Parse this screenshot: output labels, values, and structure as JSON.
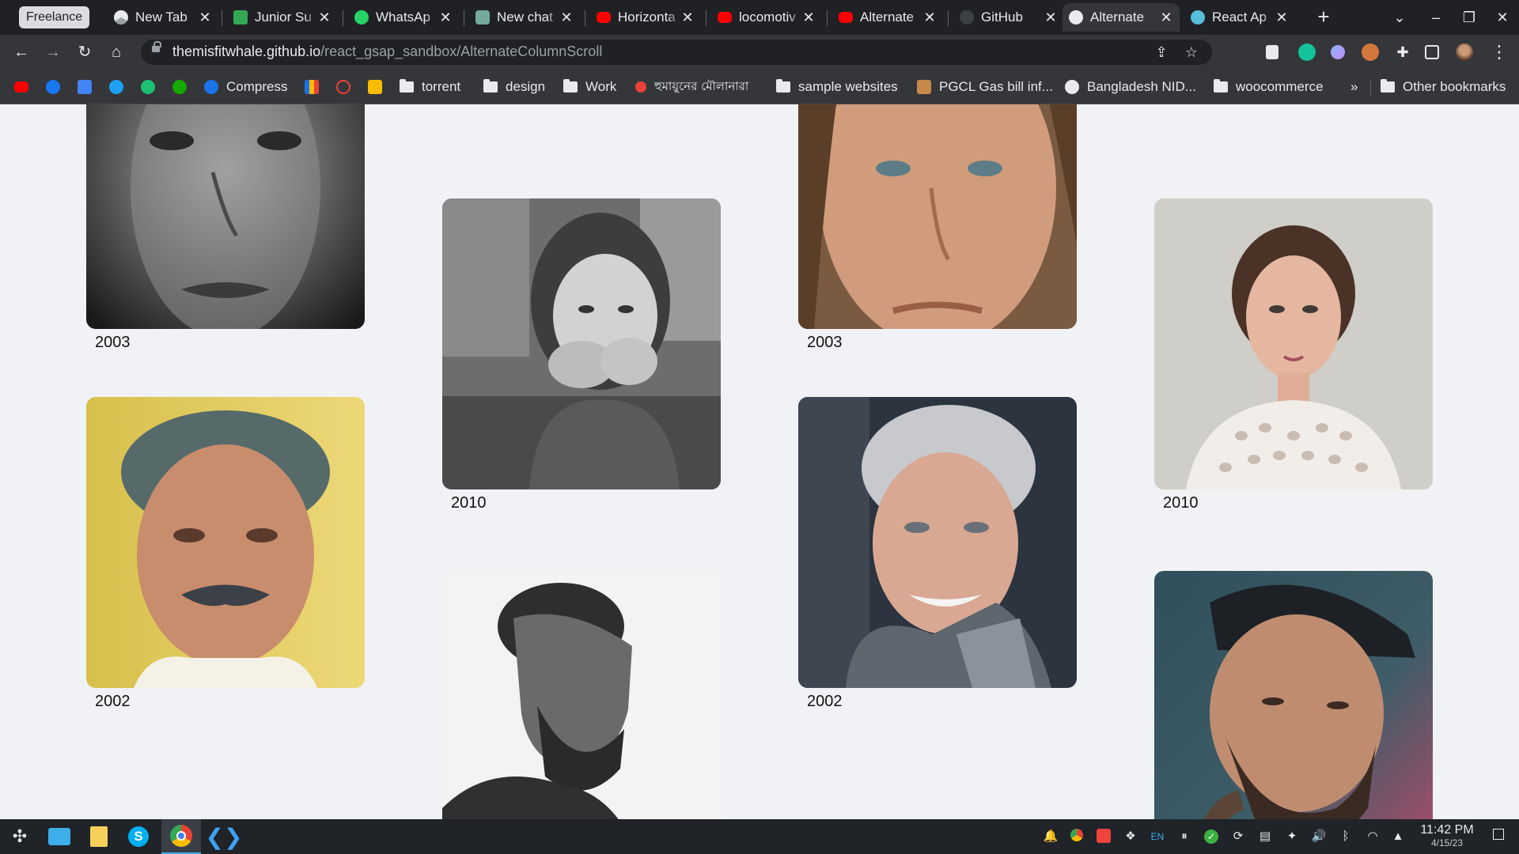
{
  "browser": {
    "tab_group_label": "Freelance",
    "tabs": [
      {
        "label": "New Tab",
        "favicon_color": "#e8eaed",
        "icon": "chrome-icon"
      },
      {
        "label": "Junior Su",
        "favicon_color": "#34a853",
        "icon": "sheets-icon"
      },
      {
        "label": "WhatsAp",
        "favicon_color": "#25d366",
        "icon": "whatsapp-icon"
      },
      {
        "label": "New chat",
        "favicon_color": "#74aa9c",
        "icon": "openai-icon"
      },
      {
        "label": "Horizonta",
        "favicon_color": "#ff0000",
        "icon": "youtube-icon"
      },
      {
        "label": "locomotiv",
        "favicon_color": "#ff0000",
        "icon": "youtube-icon"
      },
      {
        "label": "Alternate",
        "favicon_color": "#ff0000",
        "icon": "youtube-icon"
      },
      {
        "label": "GitHub",
        "favicon_color": "#5f6368",
        "icon": "github-icon"
      },
      {
        "label": "Alternate",
        "favicon_color": "#e8eaed",
        "icon": "globe-icon",
        "active": true
      },
      {
        "label": "React Ap",
        "favicon_color": "#61dafb",
        "icon": "react-icon"
      }
    ],
    "new_tab_symbol": "+",
    "url_host": "themisfitwhale.github.io",
    "url_path": "/react_gsap_sandbox/AlternateColumnScroll"
  },
  "bookmarks": [
    {
      "label": "",
      "icon": "youtube-icon",
      "color": "#ff0000"
    },
    {
      "label": "",
      "icon": "facebook-icon",
      "color": "#1877f2"
    },
    {
      "label": "",
      "icon": "translate-icon",
      "color": "#4285f4"
    },
    {
      "label": "",
      "icon": "bird-icon",
      "color": "#1da1f2"
    },
    {
      "label": "",
      "icon": "fiverr-icon",
      "color": "#1dbf73"
    },
    {
      "label": "",
      "icon": "upwork-icon",
      "color": "#14a800"
    },
    {
      "label": "Compress",
      "icon": "power-icon",
      "color": "#1a73e8"
    },
    {
      "label": "",
      "icon": "bar-chart-icon",
      "color": "#fbbc04"
    },
    {
      "label": "",
      "icon": "ring-icon",
      "color": "#ea4335"
    },
    {
      "label": "",
      "icon": "bulb-icon",
      "color": "#fbbc04"
    },
    {
      "label": "torrent",
      "icon": "folder-icon",
      "color": "#e8eaed"
    },
    {
      "label": "design",
      "icon": "folder-icon",
      "color": "#e8eaed"
    },
    {
      "label": "Work",
      "icon": "folder-icon",
      "color": "#e8eaed"
    },
    {
      "label": "হুমায়ুনের মৌলানারা",
      "icon": "red-dot-icon",
      "color": "#ea4335"
    },
    {
      "label": "sample websites",
      "icon": "folder-icon",
      "color": "#e8eaed"
    },
    {
      "label": "PGCL Gas bill inf...",
      "icon": "map-icon",
      "color": "#c58a4a"
    },
    {
      "label": "Bangladesh NID...",
      "icon": "globe-icon",
      "color": "#e8eaed"
    },
    {
      "label": "woocommerce",
      "icon": "folder-icon",
      "color": "#e8eaed"
    },
    {
      "label": "»",
      "icon": "overflow-chevron-icon",
      "color": "#e8eaed"
    },
    {
      "label": "Other bookmarks",
      "icon": "folder-icon",
      "color": "#e8eaed"
    }
  ],
  "gallery": {
    "cards": [
      {
        "year": "2003",
        "subject": "woman-face-closeup-bw"
      },
      {
        "year": "2002",
        "subject": "elderly-man-moustache"
      },
      {
        "year": "2010",
        "subject": "child-bw"
      },
      {
        "year": "",
        "subject": "bearded-man-profile-bw"
      },
      {
        "year": "2003",
        "subject": "freckled-man"
      },
      {
        "year": "2002",
        "subject": "elderly-woman-smiling"
      },
      {
        "year": "2010",
        "subject": "woman-lace-top"
      },
      {
        "year": "",
        "subject": "tattooed-man-cap"
      }
    ]
  },
  "taskbar": {
    "apps": [
      "launcher-icon",
      "file-manager-icon",
      "notes-icon",
      "skype-icon",
      "chrome-icon",
      "vscode-icon"
    ],
    "tray_lang": "EN",
    "time": "11:42 PM",
    "date": "4/15/23"
  }
}
